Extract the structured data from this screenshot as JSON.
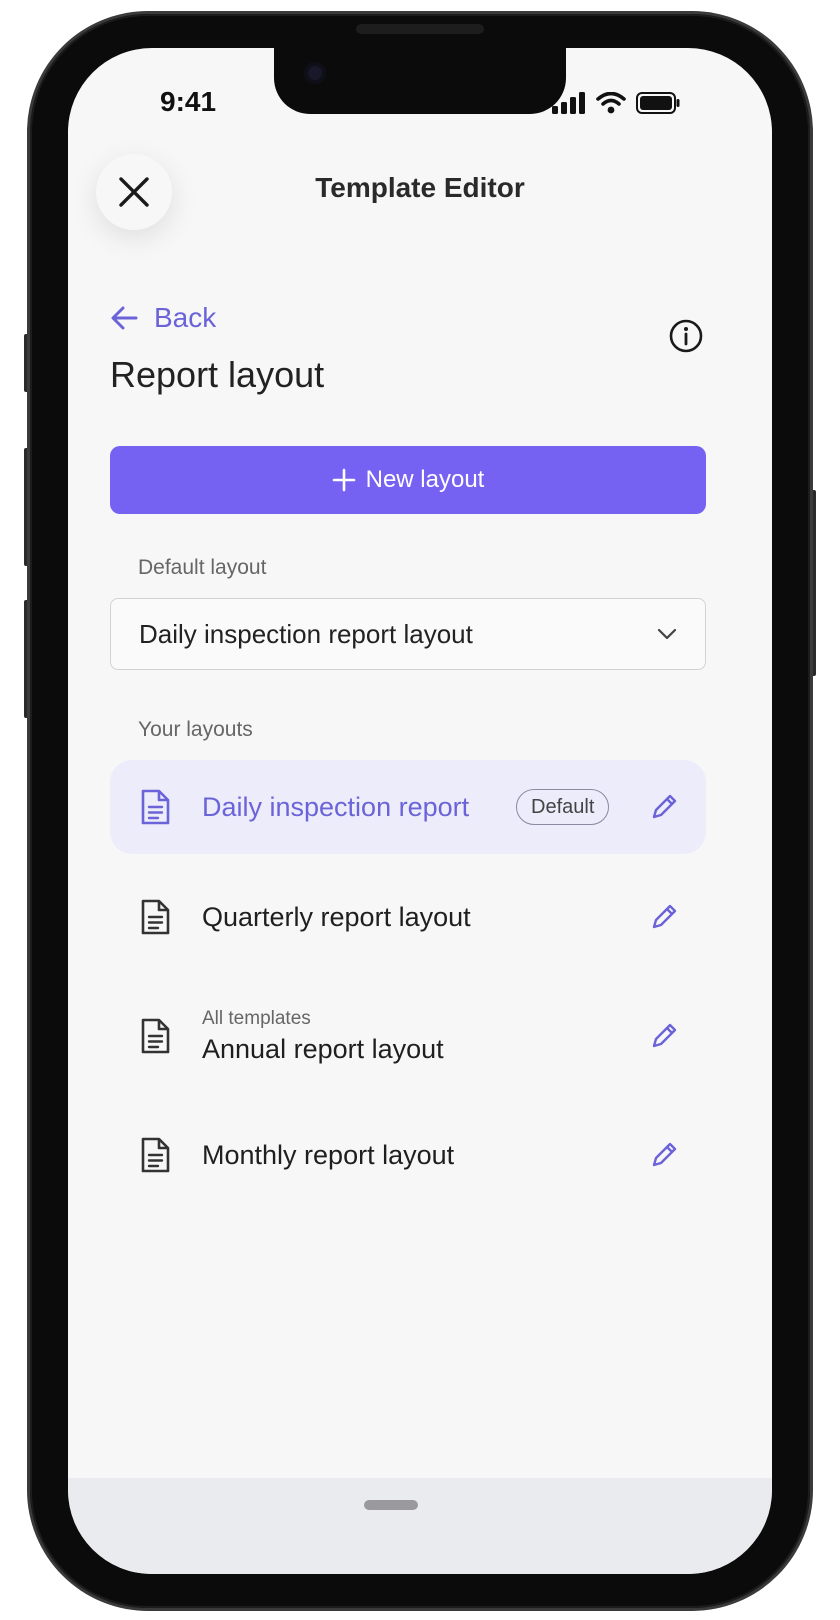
{
  "status": {
    "time": "9:41"
  },
  "header": {
    "title": "Template Editor",
    "close_icon": "close-icon"
  },
  "nav": {
    "back_label": "Back"
  },
  "page": {
    "title": "Report layout"
  },
  "actions": {
    "new_layout_label": "New layout"
  },
  "default_layout": {
    "label": "Default layout",
    "selected": "Daily inspection report layout"
  },
  "your_layouts": {
    "label": "Your layouts",
    "items": [
      {
        "label": "Daily inspection report",
        "badge": "Default",
        "subtitle": ""
      },
      {
        "label": "Quarterly report layout",
        "badge": "",
        "subtitle": ""
      },
      {
        "label": "Annual report layout",
        "badge": "",
        "subtitle": "All templates"
      },
      {
        "label": "Monthly report layout",
        "badge": "",
        "subtitle": ""
      }
    ]
  },
  "colors": {
    "accent": "#7561f2",
    "accent_text": "#6b63d8",
    "active_row": "#ececfb",
    "screen_bg": "#f7f7f8"
  }
}
